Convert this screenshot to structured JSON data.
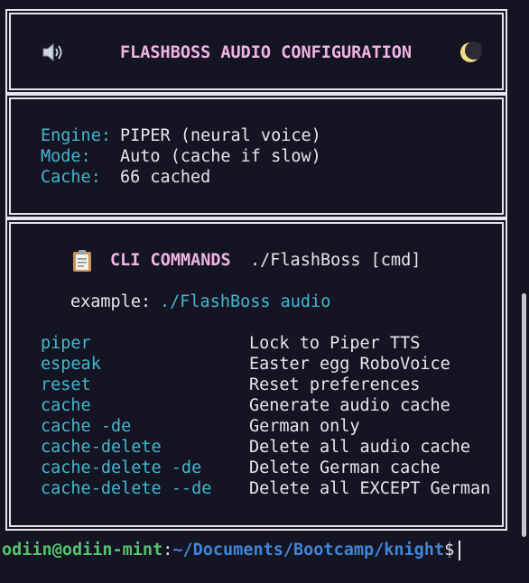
{
  "header": {
    "title": "FLASHBOSS AUDIO CONFIGURATION",
    "left_icon": "speaker-icon",
    "right_icon": "crescent-moon-icon"
  },
  "config": {
    "engine_label": "Engine:",
    "engine_value": "PIPER (neural voice)",
    "mode_label": "Mode:",
    "mode_value": "Auto (cache if slow)",
    "cache_label": "Cache:",
    "cache_value": "66 cached"
  },
  "cli": {
    "icon": "clipboard-icon",
    "heading": "CLI COMMANDS",
    "usage": "./FlashBoss [cmd]",
    "example_label": "example:",
    "example_cmd": "./FlashBoss audio",
    "commands": [
      {
        "cmd": "piper",
        "desc": "Lock to Piper TTS"
      },
      {
        "cmd": "espeak",
        "desc": "Easter egg RoboVoice"
      },
      {
        "cmd": "reset",
        "desc": "Reset preferences"
      },
      {
        "cmd": "cache",
        "desc": "Generate audio cache"
      },
      {
        "cmd": "cache -de",
        "desc": "German only"
      },
      {
        "cmd": "cache-delete",
        "desc": "Delete all audio cache"
      },
      {
        "cmd": "cache-delete -de",
        "desc": "Delete German cache"
      },
      {
        "cmd": "cache-delete --de",
        "desc": "Delete all EXCEPT German"
      }
    ]
  },
  "prompt": {
    "user_host": "odiin@odiin-mint",
    "separator": ":",
    "path": "~/Documents/Bootcamp/knight",
    "symbol": "$"
  },
  "colors": {
    "background": "#151422",
    "cyan": "#41b8cf",
    "pink": "#f1b3e4",
    "green": "#55c271",
    "blue": "#3f86d8"
  }
}
